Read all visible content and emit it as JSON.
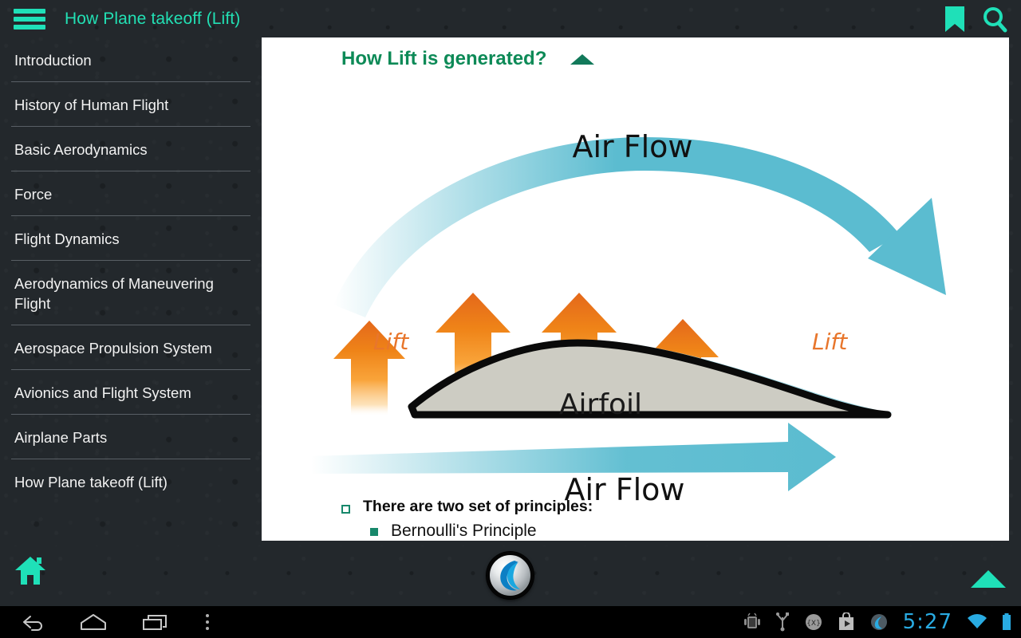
{
  "app": {
    "title": "How Plane takeoff (Lift)",
    "accent_teal": "#22E0B4",
    "panel_bg": "#ffffff",
    "shell_bg": "#23282c"
  },
  "topbar": {
    "menu_icon": "hamburger-menu-icon",
    "bookmark_icon": "bookmark-icon",
    "search_icon": "search-icon"
  },
  "sidebar": {
    "items": [
      {
        "label": "Introduction"
      },
      {
        "label": "History of Human Flight"
      },
      {
        "label": "Basic Aerodynamics"
      },
      {
        "label": "Force"
      },
      {
        "label": "Flight Dynamics"
      },
      {
        "label": "Aerodynamics of Maneuvering Flight"
      },
      {
        "label": "Aerospace Propulsion System"
      },
      {
        "label": "Avionics and Flight System"
      },
      {
        "label": "Airplane Parts"
      },
      {
        "label": "How Plane takeoff (Lift)"
      }
    ]
  },
  "content": {
    "slide_title": "How Lift is generated?",
    "collapse_icon": "collapse-triangle-up-icon",
    "diagram": {
      "airflow_top_label": "Air Flow",
      "airflow_bottom_label": "Air Flow",
      "lift_label_left": "Lift",
      "lift_label_right": "Lift",
      "airfoil_label": "Airfoil",
      "arrow_color_cyan": "#5BBCD0",
      "arrow_color_orange": "#E8761F",
      "airfoil_fill": "#CDCCC3",
      "lift_arrow_count": 4
    },
    "bullets": {
      "level1": "There are two set of principles:",
      "level2": "Bernoulli's Principle",
      "bullet_color": "#17886B"
    }
  },
  "bottombar": {
    "home_icon": "home-icon",
    "up_icon": "scroll-up-triangle-icon",
    "orb_icon": "app-orb-logo-icon"
  },
  "systembar": {
    "back_icon": "back-arrow-icon",
    "home_icon": "android-home-icon",
    "recents_icon": "recent-apps-icon",
    "menu_icon": "overflow-menu-icon",
    "usb_debug_icon": "android-debug-icon",
    "usb_icon": "usb-icon",
    "x_icon": "developer-x-icon",
    "playstore_icon": "play-store-icon",
    "app_icon": "app-notification-icon",
    "time": "5:27",
    "wifi_icon": "wifi-icon",
    "battery_icon": "battery-icon"
  }
}
